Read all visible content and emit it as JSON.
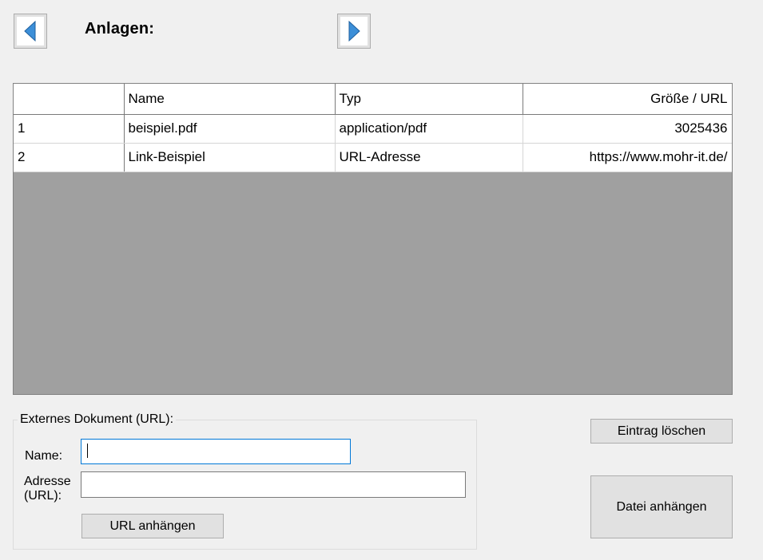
{
  "header": {
    "title": "Anlagen:",
    "prev_icon": "arrow-left-icon",
    "next_icon": "arrow-right-icon",
    "icon_color": "#3c8fd8"
  },
  "grid": {
    "columns": [
      "",
      "Name",
      "Typ",
      "Größe / URL"
    ],
    "rows": [
      {
        "num": "1",
        "name": "beispiel.pdf",
        "type": "application/pdf",
        "size_url": "3025436"
      },
      {
        "num": "2",
        "name": "Link-Beispiel",
        "type": "URL-Adresse",
        "size_url": "https://www.mohr-it.de/"
      }
    ]
  },
  "url_group": {
    "legend": "Externes Dokument (URL):",
    "name_label": "Name:",
    "address_label_1": "Adresse",
    "address_label_2": "(URL):",
    "name_value": "",
    "url_value": "",
    "add_url_button": "URL anhängen"
  },
  "actions": {
    "delete_button": "Eintrag löschen",
    "attach_file_button": "Datei anhängen"
  }
}
